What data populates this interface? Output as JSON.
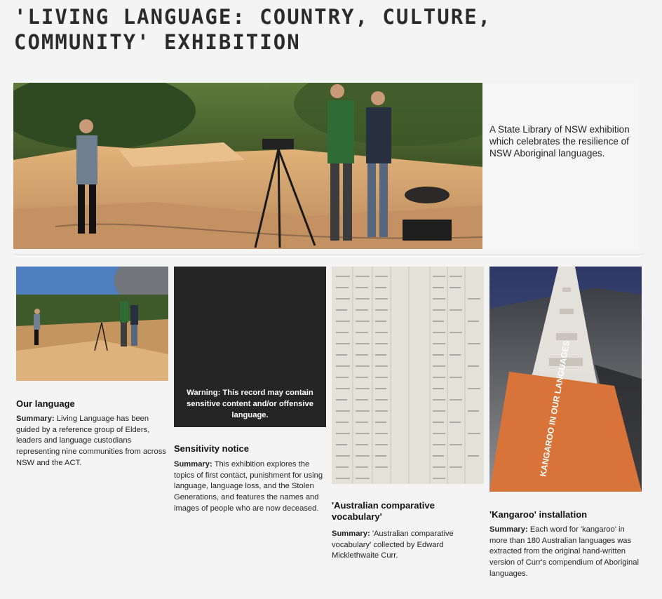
{
  "page": {
    "title": "'Living language: Country, culture, community' exhibition"
  },
  "hero": {
    "image_alt": "Three men filming on sandstone rocks by the coast with a camera on a tripod",
    "description": "A State Library of NSW exhibition which celebrates the resilience of NSW Aboriginal languages."
  },
  "cards": [
    {
      "heading": "Our language",
      "summary_label": "Summary:",
      "summary_text": "Living Language has been guided by a reference group of Elders, leaders and language custodians representing nine communities from across NSW and the ACT."
    },
    {
      "heading": "Sensitivity notice",
      "warning": "Warning: This record may contain sensitive content and/or offensive language.",
      "summary_label": "Summary:",
      "summary_text": "This exhibition explores the topics of first contact, punishment for using language, language loss, and the Stolen Generations, and features the names and images of people who are now deceased."
    },
    {
      "heading": "'Australian comparative vocabulary'",
      "summary_label": "Summary:",
      "summary_text": "'Australian comparative vocabulary' collected by Edward Micklethwaite Curr."
    },
    {
      "heading": "'Kangaroo' installation",
      "summary_label": "Summary:",
      "summary_text": "Each word for 'kangaroo' in more than 180 Australian languages was extracted from the original hand-written version of Curr's compendium of Aboriginal languages."
    }
  ],
  "colors": {
    "background": "#f4f4f4",
    "dark_card": "#252525",
    "banner_orange": "#d8743a"
  }
}
